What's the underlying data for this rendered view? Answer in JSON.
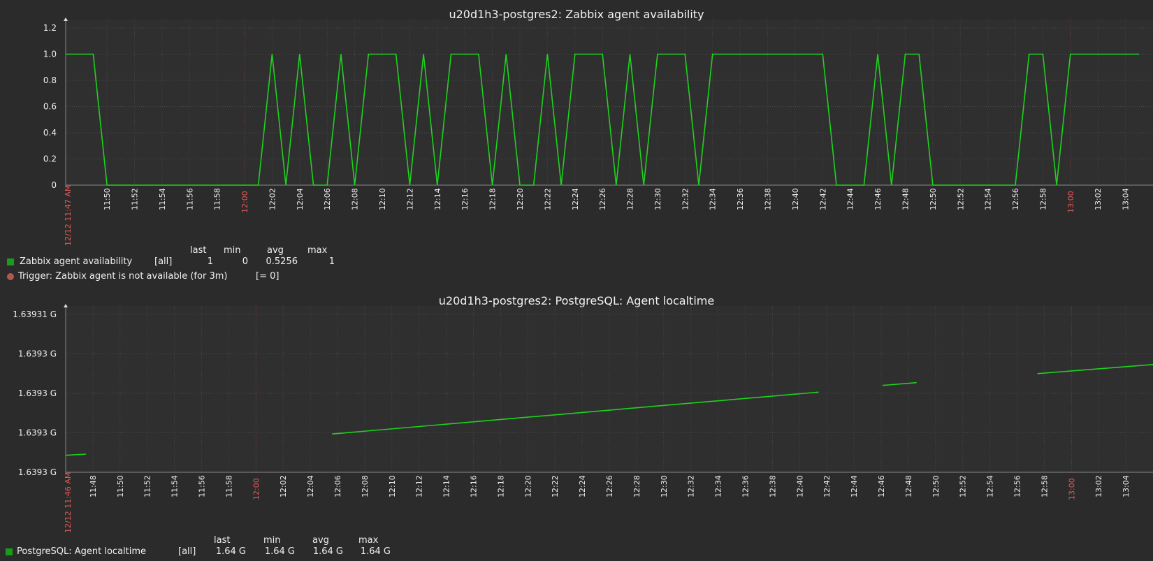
{
  "chart_data": [
    {
      "type": "line",
      "title": "u20d1h3-postgres2: Zabbix agent availability",
      "y_ticks": [
        "1.2",
        "1.0",
        "0.8",
        "0.6",
        "0.4",
        "0.2",
        "0"
      ],
      "ylim": [
        0,
        1.2
      ],
      "x_start_label": "12/12 11:47 AM",
      "x_ticks": [
        "11:50",
        "11:52",
        "11:54",
        "11:56",
        "11:58",
        "12:00",
        "12:02",
        "12:04",
        "12:06",
        "12:08",
        "12:10",
        "12:12",
        "12:14",
        "12:16",
        "12:18",
        "12:20",
        "12:22",
        "12:24",
        "12:26",
        "12:28",
        "12:30",
        "12:32",
        "12:34",
        "12:36",
        "12:38",
        "12:40",
        "12:42",
        "12:44",
        "12:46",
        "12:48",
        "12:50",
        "12:52",
        "12:54",
        "12:56",
        "12:58",
        "13:00",
        "13:02",
        "13:04"
      ],
      "x_ticks_red": [
        "12:00",
        "13:00"
      ],
      "grid": true,
      "series": [
        {
          "name": "Zabbix agent availability",
          "color": "#1ed21e",
          "points": [
            [
              "11:47",
              1
            ],
            [
              "11:49",
              1
            ],
            [
              "11:50",
              0
            ],
            [
              "12:01",
              0
            ],
            [
              "12:02",
              1
            ],
            [
              "12:03",
              0
            ],
            [
              "12:04",
              1
            ],
            [
              "12:05",
              0
            ],
            [
              "12:06",
              0
            ],
            [
              "12:07",
              1
            ],
            [
              "12:08",
              0
            ],
            [
              "12:09",
              1
            ],
            [
              "12:11",
              1
            ],
            [
              "12:12",
              0
            ],
            [
              "12:13",
              1
            ],
            [
              "12:14",
              0
            ],
            [
              "12:15",
              1
            ],
            [
              "12:17",
              1
            ],
            [
              "12:18",
              0
            ],
            [
              "12:19",
              1
            ],
            [
              "12:20",
              0
            ],
            [
              "12:21",
              0
            ],
            [
              "12:22",
              1
            ],
            [
              "12:23",
              0
            ],
            [
              "12:24",
              1
            ],
            [
              "12:26",
              1
            ],
            [
              "12:27",
              0
            ],
            [
              "12:28",
              1
            ],
            [
              "12:29",
              0
            ],
            [
              "12:30",
              1
            ],
            [
              "12:32",
              1
            ],
            [
              "12:33",
              0
            ],
            [
              "12:34",
              1
            ],
            [
              "12:42",
              1
            ],
            [
              "12:43",
              0
            ],
            [
              "12:45",
              0
            ],
            [
              "12:46",
              1
            ],
            [
              "12:47",
              0
            ],
            [
              "12:48",
              1
            ],
            [
              "12:49",
              1
            ],
            [
              "12:50",
              0
            ],
            [
              "12:56",
              0
            ],
            [
              "12:57",
              1
            ],
            [
              "12:58",
              1
            ],
            [
              "12:59",
              0
            ],
            [
              "13:00",
              1
            ],
            [
              "13:05",
              1
            ]
          ]
        }
      ],
      "legend": {
        "headers": [
          "last",
          "min",
          "avg",
          "max"
        ],
        "items": [
          {
            "marker": "square",
            "color": "#1a9c1a",
            "label": "Zabbix agent availability",
            "func": "[all]",
            "last": "1",
            "min": "0",
            "avg": "0.5256",
            "max": "1"
          }
        ],
        "trigger": {
          "marker": "circle",
          "color": "#b5584b",
          "label": "Trigger: Zabbix agent is not available (for 3m)",
          "value": "[= 0]"
        }
      }
    },
    {
      "type": "line",
      "title": "u20d1h3-postgres2: PostgreSQL: Agent localtime",
      "y_ticks": [
        "1.63931 G",
        "1.6393 G",
        "1.6393 G",
        "1.6393 G",
        "1.6393 G"
      ],
      "y_unit_note": "unix time, level index 0 (bottom) to 4 (top)",
      "ylim": [
        0,
        4
      ],
      "x_start_label": "12/12 11:46 AM",
      "x_ticks": [
        "11:48",
        "11:50",
        "11:52",
        "11:54",
        "11:56",
        "11:58",
        "12:00",
        "12:02",
        "12:04",
        "12:06",
        "12:08",
        "12:10",
        "12:12",
        "12:14",
        "12:16",
        "12:18",
        "12:20",
        "12:22",
        "12:24",
        "12:26",
        "12:28",
        "12:30",
        "12:32",
        "12:34",
        "12:36",
        "12:38",
        "12:40",
        "12:42",
        "12:44",
        "12:46",
        "12:48",
        "12:50",
        "12:52",
        "12:54",
        "12:56",
        "12:58",
        "13:00",
        "13:02",
        "13:04"
      ],
      "x_ticks_red": [
        "12:00",
        "13:00"
      ],
      "grid": true,
      "series": [
        {
          "name": "PostgreSQL: Agent localtime",
          "color": "#1ed21e",
          "segments": [
            [
              [
                "11:46",
                0.43
              ],
              [
                "11:47.5",
                0.46
              ]
            ],
            [
              [
                "12:05.6",
                0.97
              ],
              [
                "12:41.4",
                2.03
              ]
            ],
            [
              [
                "12:46.1",
                2.2
              ],
              [
                "12:48.6",
                2.27
              ]
            ],
            [
              [
                "12:57.5",
                2.5
              ],
              [
                "13:06",
                2.73
              ]
            ]
          ]
        }
      ],
      "legend": {
        "headers": [
          "last",
          "min",
          "avg",
          "max"
        ],
        "items": [
          {
            "marker": "square",
            "color": "#1a9c1a",
            "label": "PostgreSQL: Agent localtime",
            "func": "[all]",
            "last": "1.64 G",
            "min": "1.64 G",
            "avg": "1.64 G",
            "max": "1.64 G"
          }
        ]
      }
    }
  ]
}
